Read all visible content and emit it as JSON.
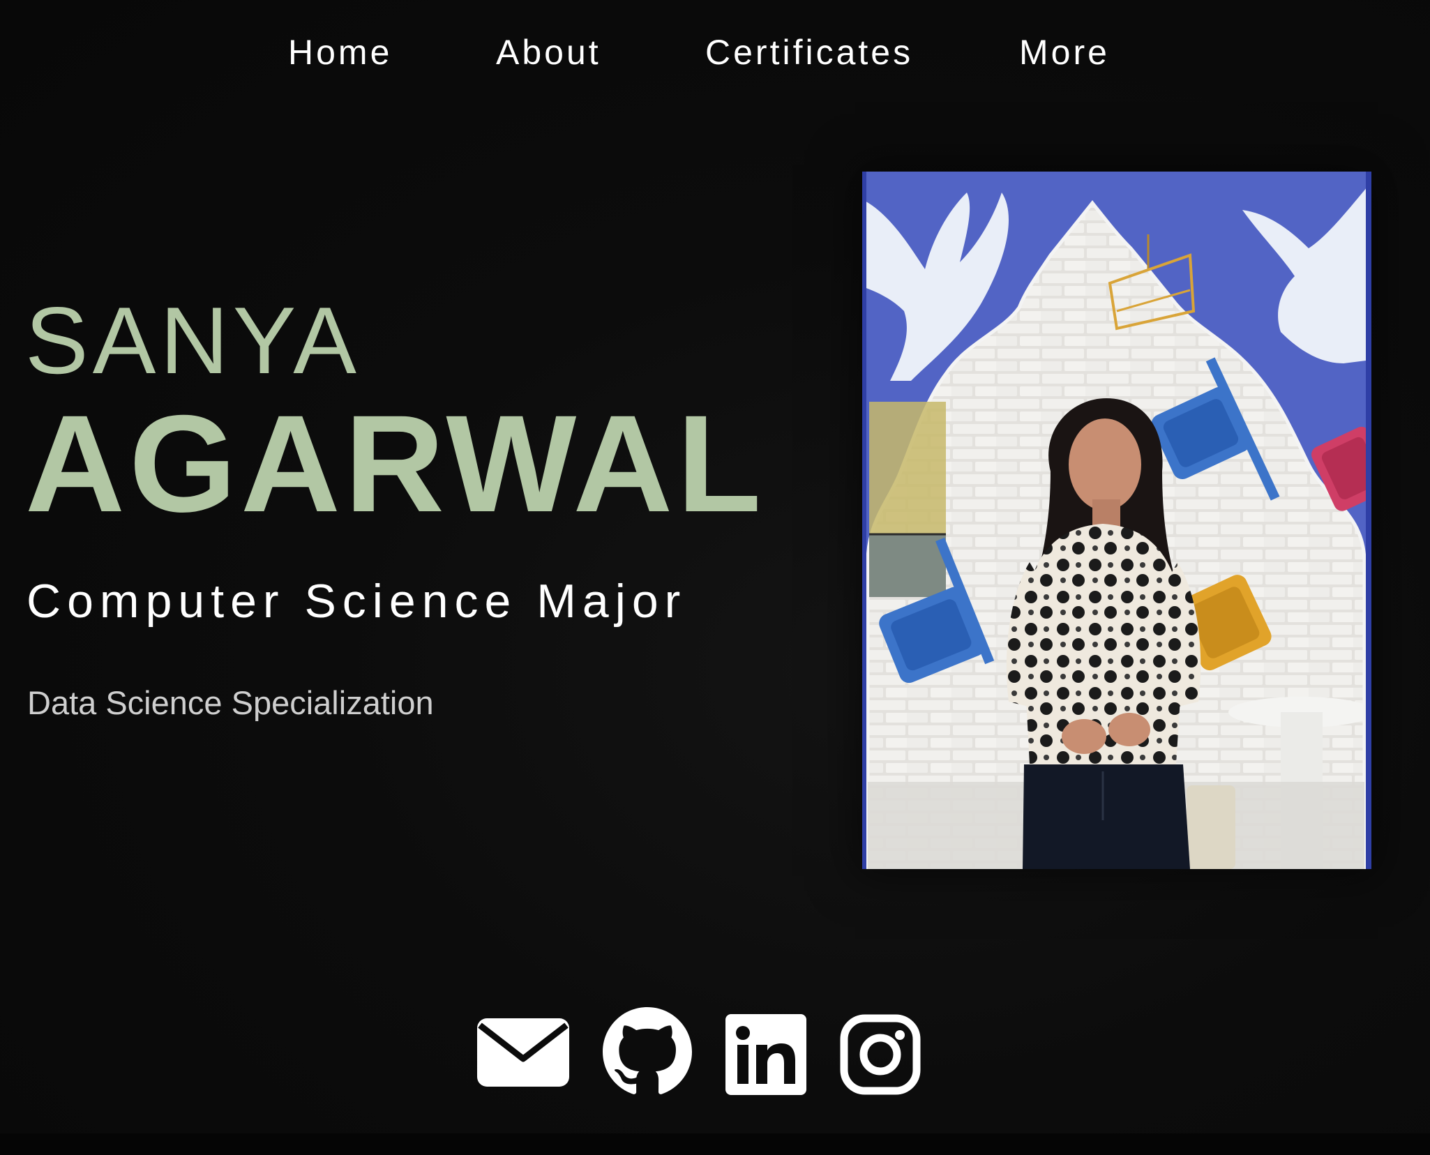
{
  "nav": {
    "items": [
      {
        "label": "Home"
      },
      {
        "label": "About"
      },
      {
        "label": "Certificates"
      },
      {
        "label": "More"
      }
    ]
  },
  "hero": {
    "first_name": "SANYA",
    "last_name": "AGARWAL",
    "title": "Computer Science Major",
    "subtitle": "Data Science Specialization"
  },
  "colors": {
    "background": "#0b0b0b",
    "name_accent": "#b2c7a4",
    "nav_text": "#ffffff",
    "subtitle_text": "#cfcfcf",
    "icon_color": "#ffffff"
  },
  "portrait": {
    "content": "photo-of-person"
  },
  "socials": [
    {
      "icon": "mail-icon"
    },
    {
      "icon": "github-icon"
    },
    {
      "icon": "linkedin-icon"
    },
    {
      "icon": "instagram-icon"
    }
  ]
}
